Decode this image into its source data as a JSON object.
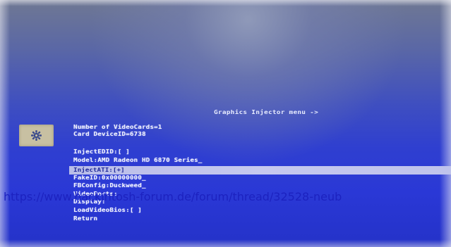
{
  "menu": {
    "title": "Graphics Injector menu ->",
    "items": [
      "Number of VideoCards=1",
      "Card DeviceID=6738",
      "InjectEDID:[ ]",
      "Model:AMD Radeon HD 6870 Series_",
      "InjectATI:[+]",
      "FakeID:0x00000000_",
      "FBConfig:Duckweed_",
      "VideoPorts:",
      "Display:",
      "LoadVideoBios:[ ]",
      "Return"
    ],
    "selected_index": 4
  },
  "settings_icon": "gear-icon",
  "watermark": "https://www.hackintosh-forum.de/forum/thread/32528-neub",
  "colors": {
    "background": "#2f3fd0",
    "text": "#eef0ff",
    "highlight": "#c6c9ef",
    "highlight_text": "#20299a",
    "icon_box": "#c8c0a2",
    "watermark": "#1c22c0"
  }
}
